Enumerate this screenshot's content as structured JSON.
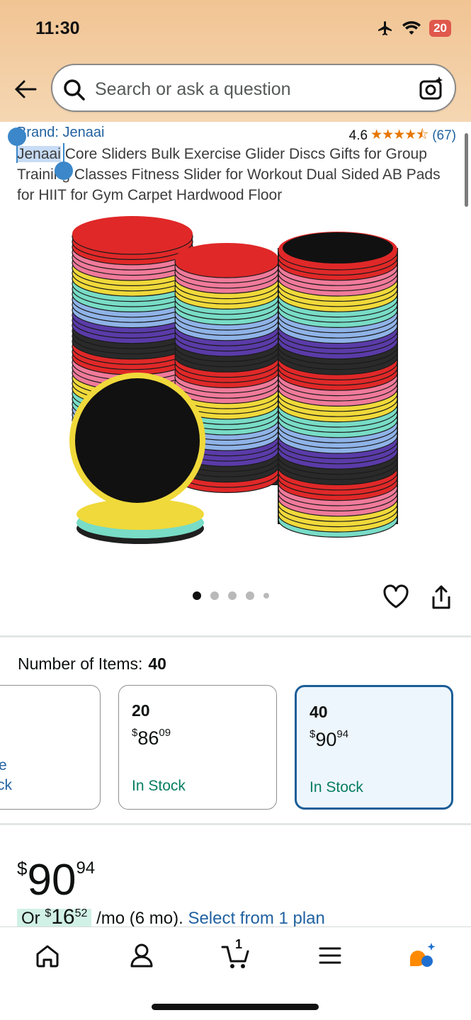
{
  "status_bar": {
    "time": "11:30",
    "battery": "20"
  },
  "search": {
    "placeholder": "Search or ask a question"
  },
  "product": {
    "brand": "Brand: Jenaai",
    "rating": "4.6",
    "stars": "★★★★⯪",
    "rating_count": "(67)",
    "title_selected": "Jenaai",
    "title_rest": " Core Sliders Bulk Exercise Glider Discs Gifts for Group Training Classes Fitness Slider for Workout Dual Sided AB Pads for HIIT for Gym Carpet Hardwood Floor"
  },
  "gallery": {
    "image_count": 5,
    "active_index": 0
  },
  "options": {
    "label": "Number of Items:",
    "selected_value": "40",
    "partial_link": "e",
    "partial_stock": "ck",
    "cards": [
      {
        "qty": "20",
        "price_cur": "$",
        "price_whole": "86",
        "price_cents": "09",
        "stock": "In Stock",
        "selected": false
      },
      {
        "qty": "40",
        "price_cur": "$",
        "price_whole": "90",
        "price_cents": "94",
        "stock": "In Stock",
        "selected": true
      }
    ]
  },
  "price": {
    "cur": "$",
    "whole": "90",
    "cents": "94"
  },
  "monthly": {
    "prefix": "Or ",
    "cur": "$",
    "whole": "16",
    "cents": "52",
    "suffix": " /mo (6 mo). ",
    "link": "Select from 1 plan"
  },
  "nav": {
    "items": [
      "home-icon",
      "account-icon",
      "cart-icon",
      "menu-icon",
      "rufus-icon"
    ],
    "cart_count": "1"
  },
  "colors": {
    "link": "#2162a1",
    "stock": "#067d62",
    "selected_border": "#1b5e98",
    "star": "#e77600",
    "header": "#f1c493"
  }
}
